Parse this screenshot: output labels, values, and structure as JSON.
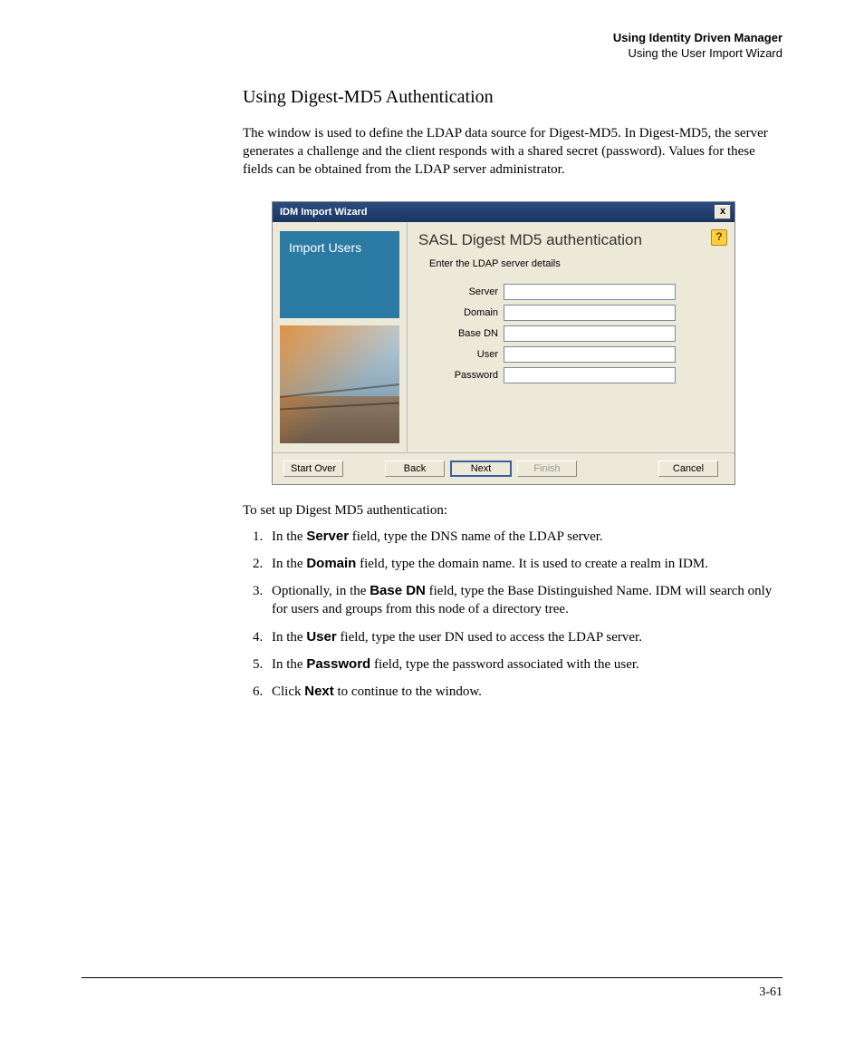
{
  "header": {
    "title_bold": "Using Identity Driven Manager",
    "subtitle": "Using the User Import Wizard"
  },
  "section": {
    "title": "Using Digest-MD5 Authentication",
    "intro_pre": "The ",
    "intro_post": " window is used to define the LDAP data source for Digest-MD5. In Digest-MD5, the server generates a challenge and the client responds with a shared secret (password). Values for these fields can be obtained from the LDAP server administrator."
  },
  "wizard": {
    "title": "IDM Import Wizard",
    "close": "x",
    "sidebar_label": "Import Users",
    "main_title": "SASL Digest MD5 authentication",
    "subtitle": "Enter the LDAP server details",
    "help": "?",
    "fields": {
      "server": "Server",
      "domain": "Domain",
      "base_dn": "Base DN",
      "user": "User",
      "password": "Password"
    },
    "buttons": {
      "start_over": "Start Over",
      "back": "Back",
      "next": "Next",
      "finish": "Finish",
      "cancel": "Cancel"
    }
  },
  "post_text": "To set up Digest MD5 authentication:",
  "steps": {
    "s1a": "In the ",
    "s1b": "Server",
    "s1c": " field, type the DNS name of the LDAP server.",
    "s2a": "In the ",
    "s2b": "Domain",
    "s2c": " field, type the domain name. It is used to create a realm in IDM.",
    "s3a": "Optionally, in the ",
    "s3b": "Base DN",
    "s3c": " field, type the Base Distinguished Name. IDM will search only for users and groups from this node of a directory tree.",
    "s4a": "In the ",
    "s4b": "User",
    "s4c": " field, type the user DN used to access the LDAP server.",
    "s5a": "In the ",
    "s5b": "Password",
    "s5c": " field, type the password associated with the user.",
    "s6a": "Click ",
    "s6b": "Next",
    "s6c": " to continue to the ",
    "s6d": " window."
  },
  "page_number": "3-61"
}
